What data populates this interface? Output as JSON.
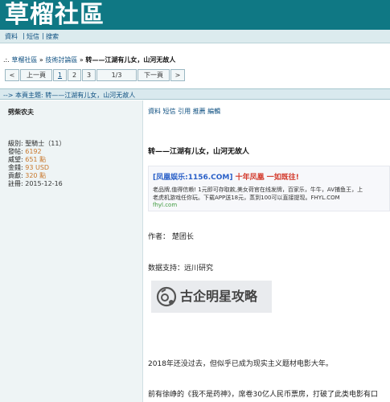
{
  "header": {
    "title": "草榴社區"
  },
  "topnav": {
    "items": [
      "資料",
      "短信",
      "搜索"
    ],
    "sep": "|"
  },
  "breadcrumb": {
    "prefix": ".:.",
    "items": [
      "草榴社區",
      "技術討論區"
    ],
    "sep": "»",
    "current": "转——江湖有儿女，山河无故人"
  },
  "pager": {
    "prev_icon": "<",
    "prev_label": "上一頁",
    "pages": [
      "1",
      "2",
      "3"
    ],
    "counter": "1/3",
    "next_label": "下一頁",
    "next_icon": ">"
  },
  "topic_bar": {
    "text": "--> 本頁主題: 转——江湖有儿女，山河无故人"
  },
  "author": {
    "name": "劈柴农夫",
    "stats": [
      {
        "k": "級別:",
        "v": "聖騎士（11）"
      },
      {
        "k": "發帖:",
        "v": "6192"
      },
      {
        "k": "威望:",
        "v": "651 點"
      },
      {
        "k": "金錢:",
        "v": "93 USD"
      },
      {
        "k": "貢獻:",
        "v": "320 點"
      },
      {
        "k": "註冊:",
        "v": "2015-12-16"
      }
    ]
  },
  "post": {
    "actions": "資料 短信 引用 推薦 編輯",
    "title": "转——江湖有儿女，山河无故人",
    "ad": {
      "title_a": "[凤凰娱乐:1156.COM] ",
      "title_b": "十年凤凰 一如既往!",
      "line1": "老品牌,值得信赖! 1元即可存取款,美女荷官在线发牌，百家乐，牛牛，AV捕鱼王，上",
      "line2": "老虎机游戏任你玩。下载APP送18元，蒸到100可以直接提现。FHYL.COM",
      "domain": "fhyl.com"
    },
    "author_line": "作者： 楚团长",
    "support_line": "数据支持：远川研究",
    "watermark": "古企明星攻略",
    "para1": "2018年还没过去，但似乎已成为现实主义题材电影大年。",
    "para2": "前有徐峥的《我不是药神》，席卷30亿人民币票房，打破了此类电影有口"
  },
  "colors": {
    "brand": "#0f7884",
    "link": "#0d4f80",
    "stat": "#c9772b",
    "ad_red": "#d33a2c",
    "ad_blue": "#2a60c8",
    "ad_green": "#3e9a3e"
  }
}
